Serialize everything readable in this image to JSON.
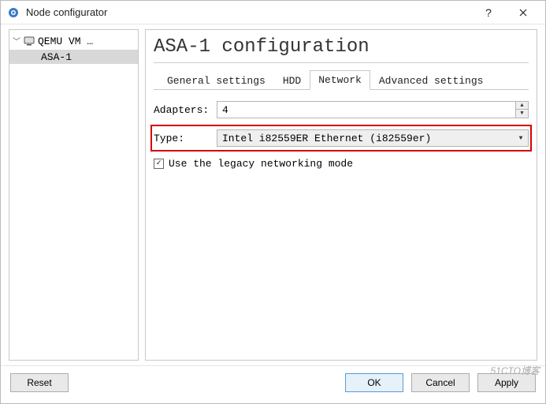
{
  "window": {
    "title": "Node configurator"
  },
  "tree": {
    "root_label": "QEMU VM …",
    "child_label": "ASA-1"
  },
  "panel": {
    "title": "ASA-1 configuration",
    "tabs": {
      "general": "General settings",
      "hdd": "HDD",
      "network": "Network",
      "advanced": "Advanced settings"
    },
    "adapters_label": "Adapters:",
    "adapters_value": "4",
    "type_label": "Type:",
    "type_value": "Intel i82559ER Ethernet (i82559er)",
    "legacy_label": "Use the legacy networking mode",
    "legacy_checked": true
  },
  "buttons": {
    "reset": "Reset",
    "ok": "OK",
    "cancel": "Cancel",
    "apply": "Apply"
  },
  "watermark": "51CTO博客"
}
